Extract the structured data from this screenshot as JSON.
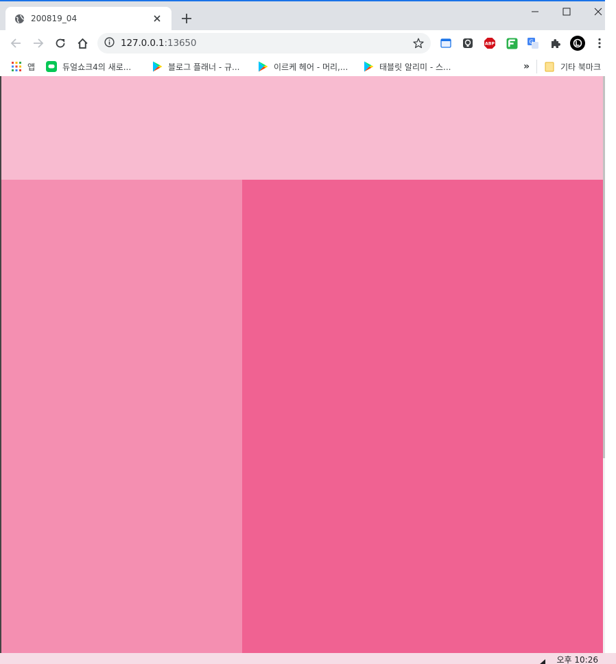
{
  "tab": {
    "title": "200819_04",
    "favicon": "globe-icon",
    "close_icon": "close-icon",
    "new_tab_icon": "plus-icon"
  },
  "window_controls": {
    "minimize_icon": "minimize-icon",
    "maximize_icon": "maximize-icon",
    "close_icon": "close-icon"
  },
  "toolbar": {
    "back_icon": "arrow-left-icon",
    "forward_icon": "arrow-right-icon",
    "reload_icon": "reload-icon",
    "home_icon": "home-icon",
    "info_icon": "info-icon",
    "url_host": "127.0.0.1",
    "url_port": ":13650",
    "bookmark_star_icon": "star-icon",
    "extensions": [
      "window-icon",
      "bulb-icon",
      "abp-icon",
      "feedly-icon",
      "translate-icon",
      "puzzle-icon",
      "avatar-icon",
      "menu-dots-icon"
    ],
    "abp_label": "ABP"
  },
  "bookmarks": {
    "items": [
      {
        "label": "앱",
        "icon": "apps-grid-icon"
      },
      {
        "label": "듀얼쇼크4의 새로...",
        "icon": "line-icon"
      },
      {
        "label": "블로그 플래너 - 규...",
        "icon": "play-store-icon"
      },
      {
        "label": "이르케 헤어 - 머리,...",
        "icon": "play-store-icon"
      },
      {
        "label": "태블릿 알리미 - 스...",
        "icon": "play-store-icon"
      }
    ],
    "overflow": "»",
    "other_folder": "기타 북마크"
  },
  "page": {
    "colors": {
      "header": "#f8bbd0",
      "left": "#f48fb1",
      "right": "#f06292"
    }
  },
  "taskbar": {
    "clock": "오후 10:26"
  }
}
